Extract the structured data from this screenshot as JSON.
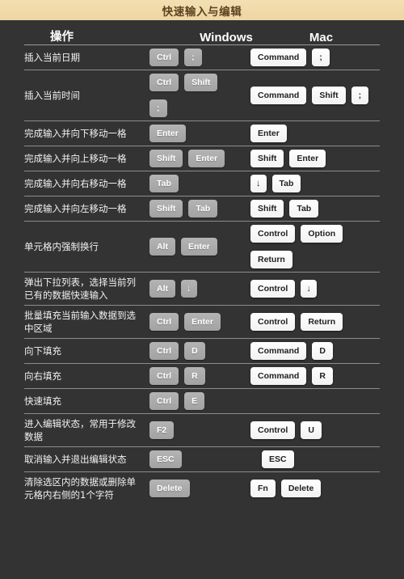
{
  "header": {
    "title": "快速输入与编辑",
    "bg_color": "#efd9a8",
    "text_color": "#5b4321"
  },
  "columns": {
    "operation": "操作",
    "windows": "Windows",
    "mac": "Mac"
  },
  "theme": {
    "background": "#333333",
    "win_key_bg": "#a8a8a8",
    "win_key_text": "#ffffff",
    "mac_key_bg": "#ffffff",
    "mac_key_text": "#1f1f1f",
    "divider": "#8c8c8c",
    "body_text": "#f2f2f2"
  },
  "rows": [
    {
      "operation": "插入当前日期",
      "windows": [
        "Ctrl",
        ";"
      ],
      "mac": [
        "Command",
        ";"
      ]
    },
    {
      "operation": "插入当前时间",
      "windows": [
        "Ctrl",
        "Shift",
        ";"
      ],
      "mac": [
        "Command",
        "Shift",
        ";"
      ],
      "wrap_after": 2
    },
    {
      "operation": "完成输入并向下移动一格",
      "windows": [
        "Enter"
      ],
      "mac": [
        "Enter"
      ]
    },
    {
      "operation": "完成输入并向上移动一格",
      "windows": [
        "Shift",
        "Enter"
      ],
      "mac": [
        "Shift",
        "Enter"
      ]
    },
    {
      "operation": "完成输入并向右移动一格",
      "windows": [
        "Tab"
      ],
      "mac": [
        "↓",
        "Tab"
      ]
    },
    {
      "operation": "完成输入并向左移动一格",
      "windows": [
        "Shift",
        "Tab"
      ],
      "mac": [
        "Shift",
        "Tab"
      ]
    },
    {
      "operation": "单元格内强制换行",
      "windows": [
        "Alt",
        "Enter"
      ],
      "mac": [
        "Control",
        "Option",
        "Return"
      ],
      "mac_wrap_after": 2
    },
    {
      "operation": "弹出下拉列表，选择当前列已有的数据快速输入",
      "windows": [
        "Alt",
        "↓"
      ],
      "mac": [
        "Control",
        "↓"
      ]
    },
    {
      "operation": "批量填充当前输入数据到选中区域",
      "windows": [
        "Ctrl",
        "Enter"
      ],
      "mac": [
        "Control",
        "Return"
      ]
    },
    {
      "operation": "向下填充",
      "windows": [
        "Ctrl",
        "D"
      ],
      "mac": [
        "Command",
        "D"
      ]
    },
    {
      "operation": "向右填充",
      "windows": [
        "Ctrl",
        "R"
      ],
      "mac": [
        "Command",
        "R"
      ]
    },
    {
      "operation": "快速填充",
      "windows": [
        "Ctrl",
        "E"
      ],
      "mac": []
    },
    {
      "operation": "进入编辑状态，常用于修改数据",
      "windows": [
        "F2"
      ],
      "mac": [
        "Control",
        "U"
      ]
    },
    {
      "operation": "取消输入并退出编辑状态",
      "windows": [
        "ESC"
      ],
      "mac": [
        "ESC"
      ],
      "mac_indent": true
    },
    {
      "operation": "清除选区内的数据或删除单元格内右侧的1个字符",
      "windows": [
        "Delete"
      ],
      "mac": [
        "Fn",
        "Delete"
      ]
    }
  ]
}
